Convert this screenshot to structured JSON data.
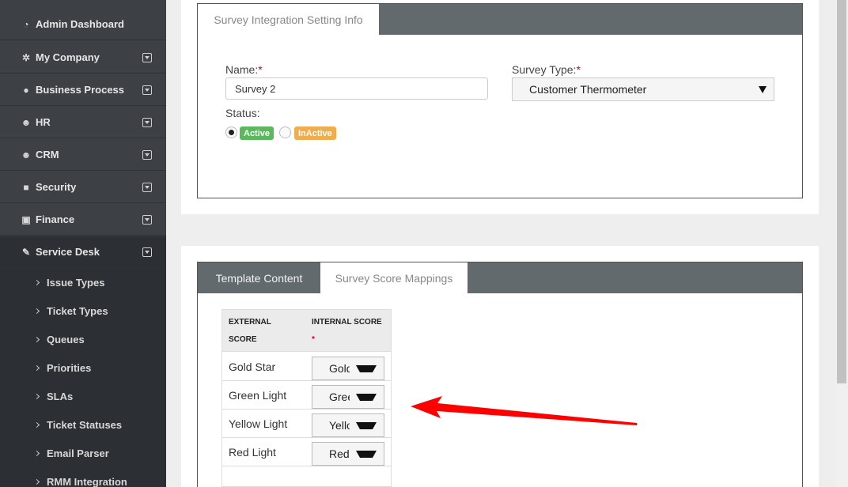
{
  "sidebar": {
    "items": [
      {
        "label": "Admin Dashboard",
        "icon": "dashboard-icon"
      },
      {
        "label": "My Company",
        "icon": "gear-icon"
      },
      {
        "label": "Business Process",
        "icon": "globe-icon"
      },
      {
        "label": "HR",
        "icon": "users-icon"
      },
      {
        "label": "CRM",
        "icon": "users-icon"
      },
      {
        "label": "Security",
        "icon": "lock-icon"
      },
      {
        "label": "Finance",
        "icon": "money-icon"
      },
      {
        "label": "Service Desk",
        "icon": "wrench-icon"
      }
    ],
    "sub_items": [
      "Issue Types",
      "Ticket Types",
      "Queues",
      "Priorities",
      "SLAs",
      "Ticket Statuses",
      "Email Parser",
      "RMM Integration"
    ]
  },
  "settings": {
    "tab_label": "Survey Integration Setting Info",
    "name_label": "Name:",
    "required_mark": "*",
    "name_value": "Survey 2",
    "type_label": "Survey Type:",
    "type_value": "Customer Thermometer",
    "status_label": "Status:",
    "active_label": "Active",
    "inactive_label": "InActive",
    "status_selected": "Active"
  },
  "template": {
    "tabs": [
      "Template Content",
      "Survey Score Mappings"
    ],
    "active_tab": "Survey Score Mappings",
    "score_table": {
      "external_header": [
        "EXTERNAL",
        "SCORE"
      ],
      "internal_header": "INTERNAL SCORE",
      "rows": [
        {
          "external": "Gold Star",
          "internal": "Gold"
        },
        {
          "external": "Green Light",
          "internal": "Green"
        },
        {
          "external": "Yellow Light",
          "internal": "Yellow"
        },
        {
          "external": "Red Light",
          "internal": "Red"
        }
      ]
    }
  },
  "colors": {
    "sidebar_bg": "#3d4145",
    "tab_bar": "#636a6e",
    "active_badge": "#5cb85c",
    "inactive_badge": "#f0ad4e",
    "required": "#d0021b",
    "annotation_arrow": "#ff0000"
  }
}
